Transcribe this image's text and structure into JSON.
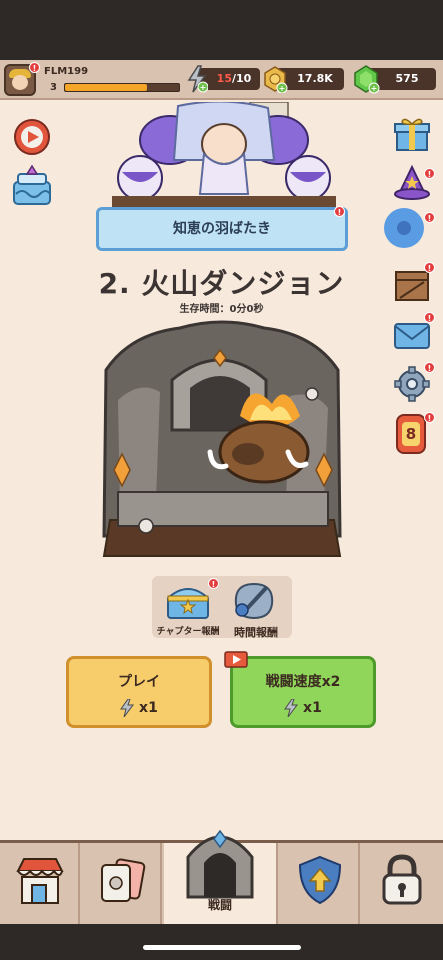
{
  "player": {
    "name": "FLM199",
    "level": "3",
    "xp_fraction": 0.72
  },
  "resources": {
    "energy_current": "15",
    "energy_max": "/10",
    "gold": "17.8K",
    "gems": "575"
  },
  "event": {
    "title": "知恵の羽ばたき"
  },
  "stage": {
    "title": "2. 火山ダンジョン",
    "survival": "生存時間：0分0秒"
  },
  "rewards": {
    "chapter_label": "チャプター報酬",
    "time_label": "時間報酬"
  },
  "actions": {
    "play_label": "プレイ",
    "play_cost": "x1",
    "speed_label": "戦闘速度x2",
    "speed_cost": "x1"
  },
  "side_badges": {
    "calendar_day": "8"
  },
  "nav": {
    "battle_label": "戦闘"
  },
  "colors": {
    "play": "#f7cd6c",
    "speed": "#8fd65a",
    "accent_red": "#e43d3d",
    "banner": "#bfe3f5"
  }
}
